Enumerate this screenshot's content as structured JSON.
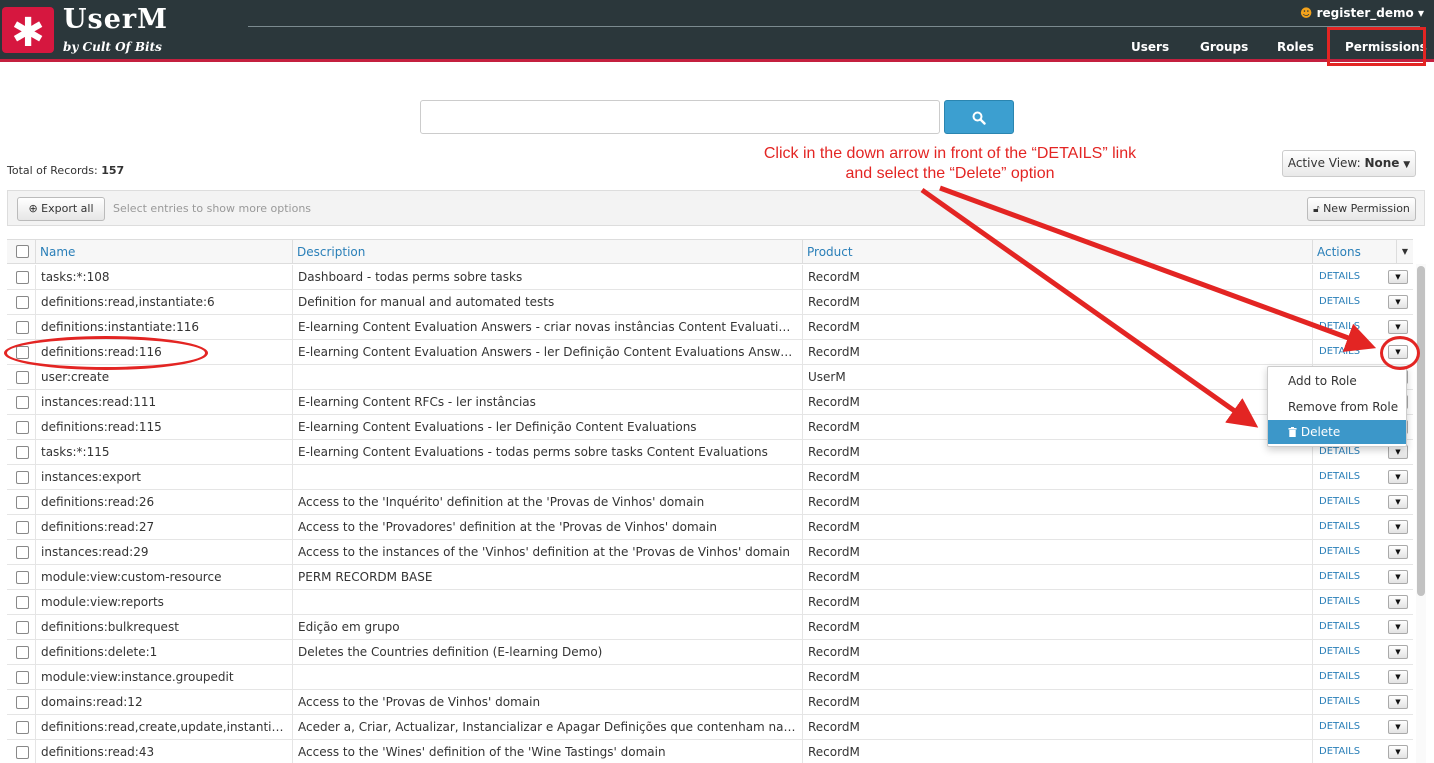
{
  "header": {
    "logo_glyph": "✱",
    "brand_name": "UserM",
    "brand_sub": "by Cult Of Bits",
    "user_icon": "user-icon",
    "username": "register_demo",
    "nav": {
      "users": "Users",
      "groups": "Groups",
      "roles": "Roles",
      "permissions": "Permissions"
    }
  },
  "search": {
    "value": "",
    "placeholder": "",
    "button_icon": "⌕"
  },
  "total_records_label": "Total of Records:",
  "total_records_value": "157",
  "annotation": {
    "line1": "Click in the down arrow in front of the “DETAILS” link",
    "line2": "and select the “Delete” option"
  },
  "active_view": {
    "label": "Active View:",
    "value": "None"
  },
  "toolbar": {
    "export_label": "Export all",
    "hint": "Select entries to show more options",
    "new_permission_label": "New Permission"
  },
  "table": {
    "columns": {
      "name": "Name",
      "description": "Description",
      "product": "Product",
      "actions": "Actions"
    },
    "details_label": "DETAILS",
    "rows": [
      {
        "name": "tasks:*:108",
        "description": "Dashboard - todas perms sobre tasks",
        "product": "RecordM"
      },
      {
        "name": "definitions:read,instantiate:6",
        "description": "Definition for manual and automated tests",
        "product": "RecordM"
      },
      {
        "name": "definitions:instantiate:116",
        "description": "E-learning Content Evaluation Answers - criar novas instâncias Content Evaluations Answers",
        "product": "RecordM"
      },
      {
        "name": "definitions:read:116",
        "description": "E-learning Content Evaluation Answers - ler Definição Content Evaluations Answers",
        "product": "RecordM"
      },
      {
        "name": "user:create",
        "description": "",
        "product": "UserM"
      },
      {
        "name": "instances:read:111",
        "description": "E-learning Content RFCs - ler instâncias",
        "product": "RecordM"
      },
      {
        "name": "definitions:read:115",
        "description": "E-learning Content Evaluations - ler Definição Content Evaluations",
        "product": "RecordM"
      },
      {
        "name": "tasks:*:115",
        "description": "E-learning Content Evaluations - todas perms sobre tasks Content Evaluations",
        "product": "RecordM"
      },
      {
        "name": "instances:export",
        "description": "",
        "product": "RecordM"
      },
      {
        "name": "definitions:read:26",
        "description": "Access to the 'Inquérito' definition at the 'Provas de Vinhos' domain",
        "product": "RecordM"
      },
      {
        "name": "definitions:read:27",
        "description": "Access to the 'Provadores' definition at the 'Provas de Vinhos' domain",
        "product": "RecordM"
      },
      {
        "name": "instances:read:29",
        "description": "Access to the instances of the 'Vinhos' definition at the 'Provas de Vinhos' domain",
        "product": "RecordM"
      },
      {
        "name": "module:view:custom-resource",
        "description": "PERM RECORDM BASE",
        "product": "RecordM"
      },
      {
        "name": "module:view:reports",
        "description": "",
        "product": "RecordM"
      },
      {
        "name": "definitions:bulkrequest",
        "description": "Edição em grupo",
        "product": "RecordM"
      },
      {
        "name": "definitions:delete:1",
        "description": "Deletes the Countries definition (E-learning Demo)",
        "product": "RecordM"
      },
      {
        "name": "module:view:instance.groupedit",
        "description": "",
        "product": "RecordM"
      },
      {
        "name": "domains:read:12",
        "description": "Access to the 'Provas de Vinhos' domain",
        "product": "RecordM"
      },
      {
        "name": "definitions:read,create,update,instantiate,...",
        "description": "Aceder a, Criar, Actualizar, Instancializar e Apagar Definições que contenham na descriçã...",
        "product": "RecordM"
      },
      {
        "name": "definitions:read:43",
        "description": "Access to the 'Wines' definition of the 'Wine Tastings' domain",
        "product": "RecordM"
      }
    ]
  },
  "dropdown": {
    "add_to_role": "Add to Role",
    "remove_from_role": "Remove from Role",
    "delete": "Delete",
    "delete_icon": "trash-icon"
  },
  "colors": {
    "header_bg": "#2b373b",
    "brand_red": "#d6173f",
    "link_blue": "#2a7fb8",
    "primary_blue": "#3c9fd0",
    "annotation_red": "#e32523"
  }
}
